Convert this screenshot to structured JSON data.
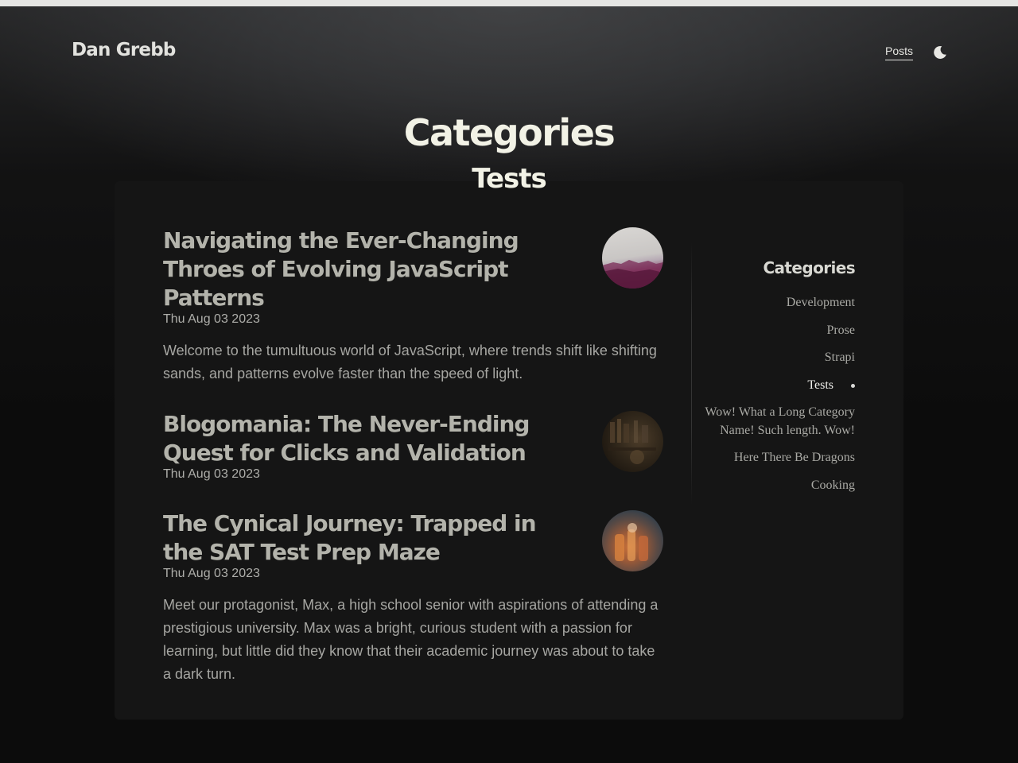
{
  "header": {
    "site_title": "Dan Grebb",
    "nav": [
      {
        "label": "Posts",
        "active": true
      }
    ],
    "theme_toggle_icon": "moon-icon"
  },
  "page": {
    "title": "Categories",
    "subtitle": "Tests"
  },
  "posts": [
    {
      "title": "Navigating the Ever-Changing Throes of Evolving JavaScript Patterns",
      "date": "Thu Aug 03 2023",
      "excerpt": "Welcome to the tumultuous world of JavaScript, where trends shift like shifting sands, and patterns evolve faster than the speed of light.",
      "thumbnail_icon": "post-thumbnail-image"
    },
    {
      "title": "Blogomania: The Never-Ending Quest for Clicks and Validation",
      "date": "Thu Aug 03 2023",
      "excerpt": "",
      "thumbnail_icon": "post-thumbnail-image"
    },
    {
      "title": "The Cynical Journey: Trapped in the SAT Test Prep Maze",
      "date": "Thu Aug 03 2023",
      "excerpt": "Meet our protagonist, Max, a high school senior with aspirations of attending a prestigious university. Max was a bright, curious student with a passion for learning, but little did they know that their academic journey was about to take a dark turn.",
      "thumbnail_icon": "post-thumbnail-image"
    }
  ],
  "sidebar": {
    "heading": "Categories",
    "items": [
      {
        "label": "Development",
        "active": false
      },
      {
        "label": "Prose",
        "active": false
      },
      {
        "label": "Strapi",
        "active": false
      },
      {
        "label": "Tests",
        "active": true
      },
      {
        "label": "Wow! What a Long Category Name! Such length. Wow!",
        "active": false
      },
      {
        "label": "Here There Be Dragons",
        "active": false
      },
      {
        "label": "Cooking",
        "active": false
      }
    ]
  },
  "colors": {
    "background": "#0c0c0c",
    "card": "#151515",
    "heading": "#f2f2e6",
    "post_title": "#b3b3ab",
    "body_text": "#a6a6a2",
    "active_category": "#eeeeea"
  }
}
